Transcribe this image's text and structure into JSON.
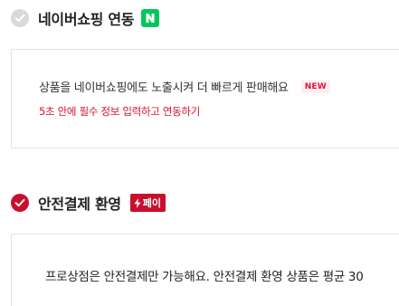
{
  "naver_section": {
    "title": "네이버쇼핑 연동",
    "badge_icon": "naver-n-icon",
    "badge_color": "#03c75a",
    "checked": false,
    "description": "상품을 네이버쇼핑에도 노출시켜 더 빠르게 판매해요",
    "new_tag": "NEW",
    "action_link": "5초 안에 필수 정보 입력하고 연동하기"
  },
  "safe_payment_section": {
    "title": "안전결제 환영",
    "badge_label": "페이",
    "badge_icon": "lightning-icon",
    "badge_color": "#c8102e",
    "checked": true,
    "description": "프로상점은 안전결제만 가능해요. 안전결제 환영 상품은 평균 30"
  },
  "colors": {
    "accent_red": "#c8102e",
    "link_red": "#d7142e",
    "unchecked_grey": "#d9d9d9",
    "naver_green": "#03c75a"
  }
}
